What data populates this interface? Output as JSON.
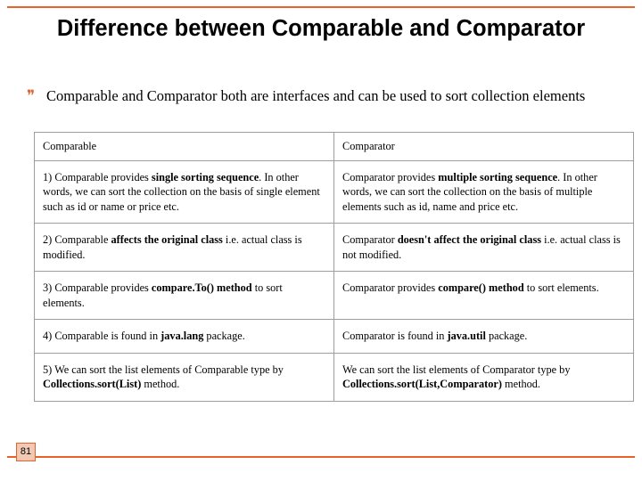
{
  "slide": {
    "title": "Difference between Comparable and Comparator",
    "bullet": {
      "glyph": "❞",
      "text": "Comparable and Comparator both are interfaces and can be used to sort collection elements"
    },
    "page_number": "81",
    "accent_color": "#E8622A",
    "page_box_fill": "#F2C9B4"
  },
  "table": {
    "headers": [
      "Comparable",
      "Comparator"
    ],
    "rows": [
      {
        "comparable": {
          "pre": "1) Comparable provides ",
          "bold": "single sorting sequence",
          "post": ". In other words, we can sort the collection on the basis of single element such as id or name or price etc."
        },
        "comparator": {
          "pre": "Comparator provides ",
          "bold": "multiple sorting sequence",
          "post": ". In other words, we can sort the collection on the basis of multiple elements such as id, name and price etc."
        }
      },
      {
        "comparable": {
          "pre": "2) Comparable ",
          "bold": "affects the original class",
          "post": " i.e. actual class is modified."
        },
        "comparator": {
          "pre": "Comparator ",
          "bold": "doesn't affect the original class",
          "post": " i.e. actual class is not modified."
        }
      },
      {
        "comparable": {
          "pre": "3) Comparable provides ",
          "bold": "compare.To() method",
          "post": " to sort elements."
        },
        "comparator": {
          "pre": "Comparator provides ",
          "bold": "compare() method",
          "post": " to sort elements."
        }
      },
      {
        "comparable": {
          "pre": "4) Comparable is found in ",
          "bold": "java.lang",
          "post": " package."
        },
        "comparator": {
          "pre": "Comparator is found in ",
          "bold": "java.util",
          "post": " package."
        }
      },
      {
        "comparable": {
          "pre": "5) We can sort the list elements of Comparable type by ",
          "bold": "Collections.sort(List)",
          "post": " method."
        },
        "comparator": {
          "pre": "We can sort the list elements of Comparator type by ",
          "bold": "Collections.sort(List,Comparator)",
          "post": " method."
        }
      }
    ]
  }
}
